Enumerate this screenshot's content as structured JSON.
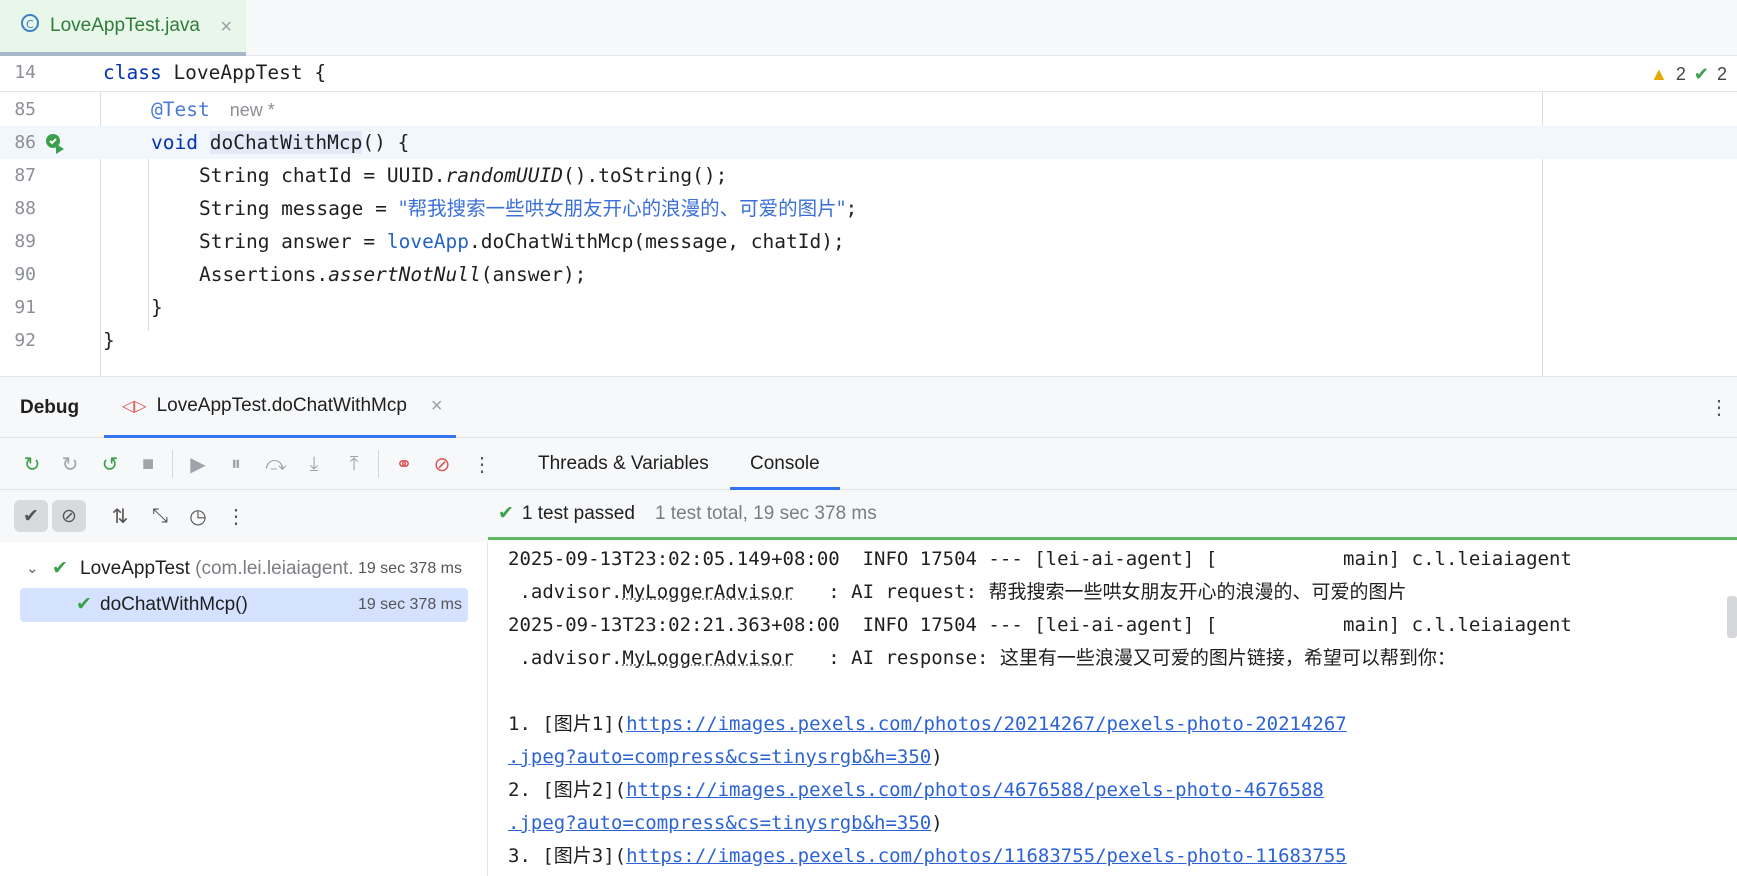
{
  "editor_tab": {
    "label": "LoveAppTest.java",
    "close": "×"
  },
  "inspections": {
    "warnings": "2",
    "weak_warnings": "2"
  },
  "code": {
    "sticky": {
      "num": "14",
      "kw": "class",
      "rest": " LoveAppTest {"
    },
    "l85": {
      "num": "85",
      "annotation": "@Test",
      "hint": "new *"
    },
    "l86": {
      "num": "86",
      "kw": "void",
      "method": "doChatWithMcp",
      "rest": "() {"
    },
    "l87": {
      "num": "87",
      "a": "String chatId = UUID.",
      "b": "randomUUID",
      "c": "().toString();"
    },
    "l88": {
      "num": "88",
      "a": "String message = ",
      "str": "\"帮我搜索一些哄女朋友开心的浪漫的、可爱的图片\"",
      "c": ";"
    },
    "l89": {
      "num": "89",
      "a": "String answer = ",
      "f": "loveApp",
      "c": ".doChatWithMcp(message, chatId);"
    },
    "l90": {
      "num": "90",
      "a": "Assertions.",
      "b": "assertNotNull",
      "c": "(answer);"
    },
    "l91": {
      "num": "91",
      "t": "}"
    },
    "l92": {
      "num": "92",
      "t": "}"
    }
  },
  "debug": {
    "title": "Debug",
    "tab": "LoveAppTest.doChatWithMcp",
    "close": "×"
  },
  "panel_tabs": {
    "threads": "Threads & Variables",
    "console": "Console"
  },
  "status": {
    "passed": "1 test passed",
    "summary": "1 test total, 19 sec 378 ms"
  },
  "tree": {
    "root_label": "LoveAppTest",
    "root_pkg": "(com.lei.leiaiagent.",
    "root_dur": "19 sec 378 ms",
    "child_label": "doChatWithMcp()",
    "child_dur": "19 sec 378 ms"
  },
  "console": {
    "l1": "2025-09-13T23:02:05.149+08:00  INFO 17504 --- [lei-ai-agent] [           main] c.l.leiaiagent",
    "l2a": " .advisor.",
    "l2b": "MyLoggerAdvisor",
    "l2c": "   : AI request: 帮我搜索一些哄女朋友开心的浪漫的、可爱的图片",
    "l3": "2025-09-13T23:02:21.363+08:00  INFO 17504 --- [lei-ai-agent] [           main] c.l.leiaiagent",
    "l4a": " .advisor.",
    "l4b": "MyLoggerAdvisor",
    "l4c": "   : AI response: 这里有一些浪漫又可爱的图片链接，希望可以帮到你：",
    "i1a": "1. [图片1](",
    "i1u": "https://images.pexels.com/photos/20214267/pexels-photo-20214267",
    "i1u2": ".jpeg?auto=compress&cs=tinysrgb&h=350",
    "i1e": ")",
    "i2a": "2. [图片2](",
    "i2u": "https://images.pexels.com/photos/4676588/pexels-photo-4676588",
    "i2u2": ".jpeg?auto=compress&cs=tinysrgb&h=350",
    "i2e": ")",
    "i3a": "3. [图片3](",
    "i3u": "https://images.pexels.com/photos/11683755/pexels-photo-11683755"
  }
}
